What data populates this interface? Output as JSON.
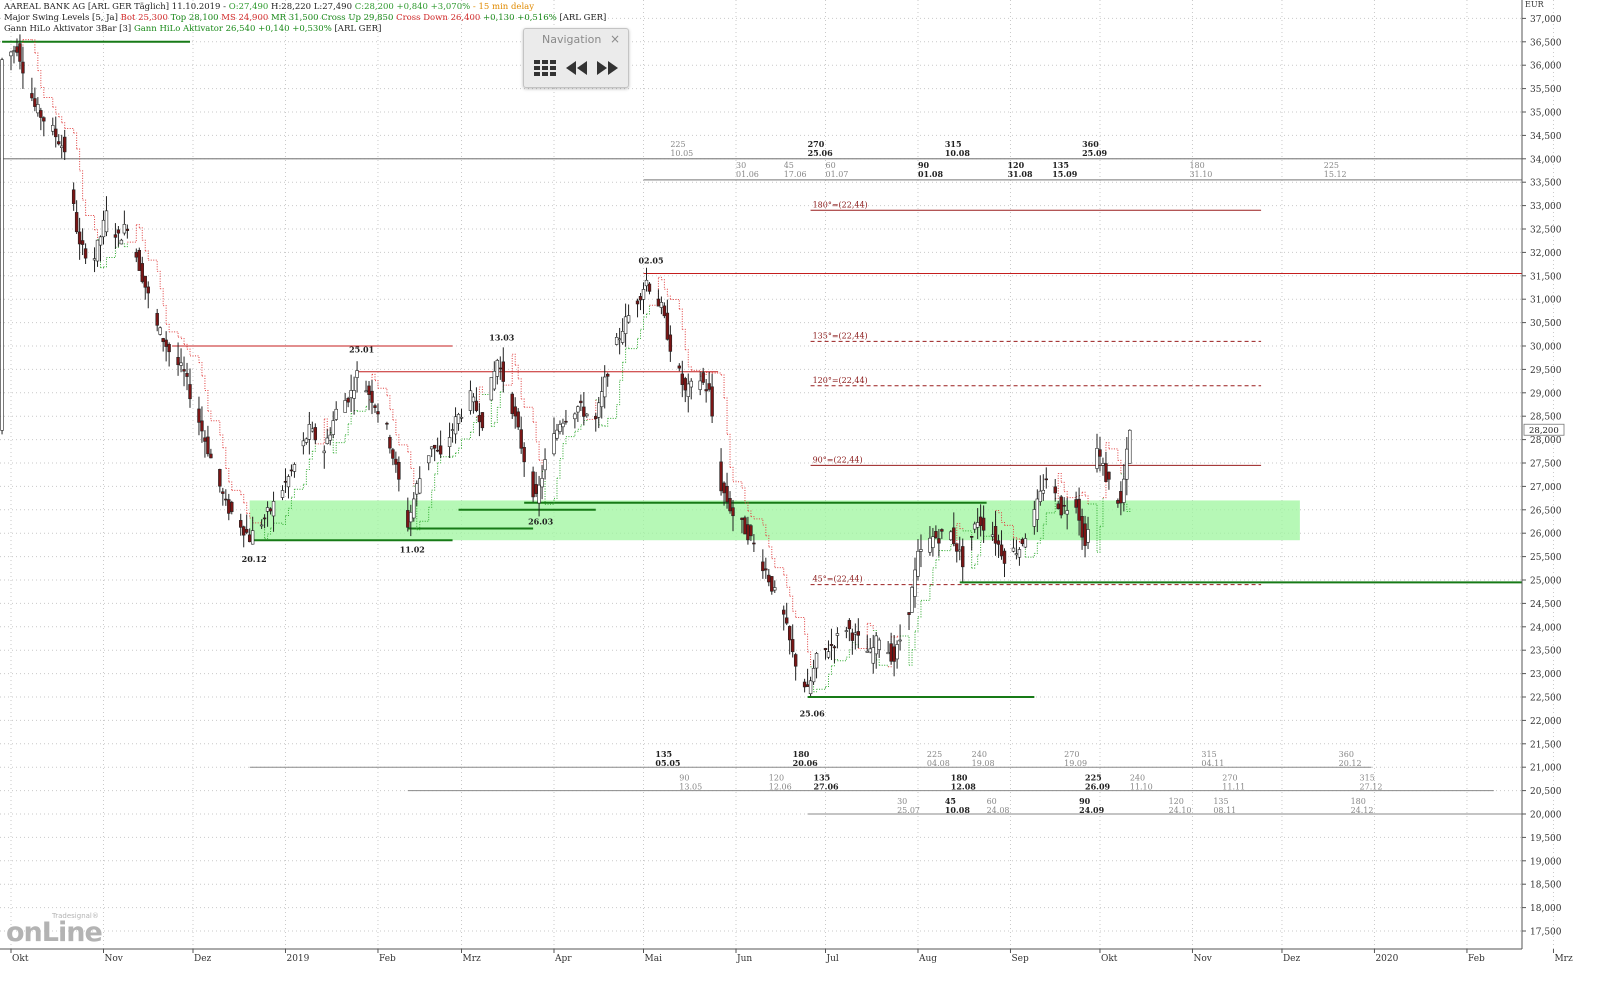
{
  "header": {
    "line1": [
      {
        "text": "AAREAL BANK AG [ARL GER Täglich] 11.10.2019 - ",
        "color": "#222222"
      },
      {
        "text": "O:27,490",
        "color": "#2e9a2e"
      },
      {
        "text": " H:28,220 L:27,490 ",
        "color": "#222222"
      },
      {
        "text": "C:28,200 +0,840 +3,070%",
        "color": "#2e9a2e"
      },
      {
        "text": " - 15 min delay",
        "color": "#e08a00"
      }
    ],
    "line2": [
      {
        "text": "Major Swing Levels [5, Ja] ",
        "color": "#222222"
      },
      {
        "text": "Bot 25,300",
        "color": "#d22a2a"
      },
      {
        "text": " Top 28,100",
        "color": "#1a8a1a"
      },
      {
        "text": " MS 24,900",
        "color": "#d22a2a"
      },
      {
        "text": " MR 31,500",
        "color": "#1a8a1a"
      },
      {
        "text": " Cross Up 29,850",
        "color": "#1a8a1a"
      },
      {
        "text": " Cross Down 26,400",
        "color": "#d22a2a"
      },
      {
        "text": " +0,130 +0,516%",
        "color": "#1a8a1a"
      },
      {
        "text": " [ARL GER]",
        "color": "#222222"
      }
    ],
    "line3": [
      {
        "text": "Gann HiLo Aktivator 3Bar [3] ",
        "color": "#222222"
      },
      {
        "text": "Gann HiLo Aktivator 26,540 +0,140 +0,530%",
        "color": "#1a8a1a"
      },
      {
        "text": " [ARL GER]",
        "color": "#222222"
      }
    ]
  },
  "navigation": {
    "title": "Navigation",
    "close": "×",
    "buttons": [
      "grid-icon",
      "rewind-icon",
      "fast-forward-icon"
    ]
  },
  "logo": {
    "big": "onLine",
    "small": "Tradesignal®"
  },
  "colors": {
    "up": "#ffffff",
    "down": "#7b1515",
    "resistance": "#c41e1e",
    "support": "#177a17",
    "zone": "#9ef59e",
    "gann_up": "#2eaa2e",
    "gann_down": "#e04040"
  },
  "chart_data": {
    "type": "candlestick",
    "currency": "EUR",
    "ylim": [
      17000,
      37500
    ],
    "y_ticks": [
      "17,500",
      "18,000",
      "18,500",
      "19,000",
      "19,500",
      "20,000",
      "20,500",
      "21,000",
      "21,500",
      "22,000",
      "22,500",
      "23,000",
      "23,500",
      "24,000",
      "24,500",
      "25,000",
      "25,500",
      "26,000",
      "26,500",
      "27,000",
      "27,500",
      "28,000",
      "28,500",
      "29,000",
      "29,500",
      "30,000",
      "30,500",
      "31,000",
      "31,500",
      "32,000",
      "32,500",
      "33,000",
      "33,500",
      "34,000",
      "34,500",
      "35,000",
      "35,500",
      "36,000",
      "36,500",
      "37,000"
    ],
    "last_price": "28,200",
    "x_labels": [
      {
        "label": "Okt",
        "date": "2018-10-01"
      },
      {
        "label": "Nov",
        "date": "2018-11-01"
      },
      {
        "label": "Dez",
        "date": "2018-12-01"
      },
      {
        "label": "2019",
        "date": "2019-01-01"
      },
      {
        "label": "Feb",
        "date": "2019-02-01"
      },
      {
        "label": "Mrz",
        "date": "2019-03-01"
      },
      {
        "label": "Apr",
        "date": "2019-04-01"
      },
      {
        "label": "Mai",
        "date": "2019-05-01"
      },
      {
        "label": "Jun",
        "date": "2019-06-01"
      },
      {
        "label": "Jul",
        "date": "2019-07-01"
      },
      {
        "label": "Aug",
        "date": "2019-08-01"
      },
      {
        "label": "Sep",
        "date": "2019-09-01"
      },
      {
        "label": "Okt",
        "date": "2019-10-01"
      },
      {
        "label": "Nov",
        "date": "2019-11-01"
      },
      {
        "label": "Dez",
        "date": "2019-12-01"
      },
      {
        "label": "2020",
        "date": "2020-01-01"
      },
      {
        "label": "Feb",
        "date": "2020-02-01"
      },
      {
        "label": "Mrz",
        "date": "2020-03-01"
      }
    ],
    "xlim": [
      "2018-09-30",
      "2020-03-20"
    ],
    "price_path": [
      [
        "2018-09-28",
        36100
      ],
      [
        "2018-10-03",
        36400
      ],
      [
        "2018-10-09",
        35100
      ],
      [
        "2018-10-15",
        34600
      ],
      [
        "2018-10-19",
        34200
      ],
      [
        "2018-10-24",
        32100
      ],
      [
        "2018-10-29",
        31900
      ],
      [
        "2018-11-02",
        32800
      ],
      [
        "2018-11-06",
        32300
      ],
      [
        "2018-11-09",
        32600
      ],
      [
        "2018-11-14",
        31500
      ],
      [
        "2018-11-19",
        30400
      ],
      [
        "2018-11-23",
        29900
      ],
      [
        "2018-11-28",
        29400
      ],
      [
        "2018-12-03",
        28400
      ],
      [
        "2018-12-07",
        27600
      ],
      [
        "2018-12-12",
        26600
      ],
      [
        "2018-12-17",
        26200
      ],
      [
        "2018-12-20",
        25900
      ],
      [
        "2018-12-27",
        26500
      ],
      [
        "2019-01-03",
        27300
      ],
      [
        "2019-01-09",
        28200
      ],
      [
        "2019-01-14",
        27800
      ],
      [
        "2019-01-18",
        28600
      ],
      [
        "2019-01-23",
        29000
      ],
      [
        "2019-01-25",
        29400
      ],
      [
        "2019-01-30",
        28900
      ],
      [
        "2019-02-04",
        28200
      ],
      [
        "2019-02-08",
        27100
      ],
      [
        "2019-02-11",
        26200
      ],
      [
        "2019-02-14",
        27000
      ],
      [
        "2019-02-19",
        27900
      ],
      [
        "2019-02-22",
        27600
      ],
      [
        "2019-02-27",
        28400
      ],
      [
        "2019-03-04",
        28900
      ],
      [
        "2019-03-08",
        28400
      ],
      [
        "2019-03-13",
        29700
      ],
      [
        "2019-03-18",
        28700
      ],
      [
        "2019-03-22",
        27600
      ],
      [
        "2019-03-26",
        26700
      ],
      [
        "2019-03-29",
        27500
      ],
      [
        "2019-04-03",
        28400
      ],
      [
        "2019-04-09",
        28700
      ],
      [
        "2019-04-15",
        28400
      ],
      [
        "2019-04-19",
        29500
      ],
      [
        "2019-04-24",
        30400
      ],
      [
        "2019-04-29",
        31000
      ],
      [
        "2019-05-02",
        31400
      ],
      [
        "2019-05-07",
        30800
      ],
      [
        "2019-05-10",
        30000
      ],
      [
        "2019-05-15",
        29000
      ],
      [
        "2019-05-20",
        29300
      ],
      [
        "2019-05-23",
        29000
      ],
      [
        "2019-05-27",
        27000
      ],
      [
        "2019-05-31",
        26400
      ],
      [
        "2019-06-05",
        26000
      ],
      [
        "2019-06-11",
        25200
      ],
      [
        "2019-06-17",
        24200
      ],
      [
        "2019-06-20",
        23400
      ],
      [
        "2019-06-25",
        22600
      ],
      [
        "2019-06-28",
        23300
      ],
      [
        "2019-07-03",
        23600
      ],
      [
        "2019-07-08",
        24000
      ],
      [
        "2019-07-12",
        23700
      ],
      [
        "2019-07-16",
        23400
      ],
      [
        "2019-07-19",
        23800
      ],
      [
        "2019-07-24",
        23300
      ],
      [
        "2019-07-29",
        24400
      ],
      [
        "2019-08-01",
        25500
      ],
      [
        "2019-08-06",
        25900
      ],
      [
        "2019-08-12",
        26000
      ],
      [
        "2019-08-16",
        25400
      ],
      [
        "2019-08-21",
        26300
      ],
      [
        "2019-08-26",
        26000
      ],
      [
        "2019-08-30",
        25500
      ],
      [
        "2019-09-04",
        25700
      ],
      [
        "2019-09-09",
        26400
      ],
      [
        "2019-09-13",
        27200
      ],
      [
        "2019-09-18",
        26500
      ],
      [
        "2019-09-23",
        26700
      ],
      [
        "2019-09-26",
        25700
      ],
      [
        "2019-09-30",
        27800
      ],
      [
        "2019-10-03",
        27200
      ],
      [
        "2019-10-08",
        26600
      ],
      [
        "2019-10-11",
        28200
      ]
    ],
    "support_resistance": [
      {
        "price": 36500,
        "from": "2018-09-28",
        "to": "2018-11-30",
        "kind": "support"
      },
      {
        "price": 34000,
        "from": "2018-09-28",
        "to": "2020-03-20",
        "kind": "neutral"
      },
      {
        "price": 33550,
        "from": "2019-05-01",
        "to": "2020-03-20",
        "kind": "neutral"
      },
      {
        "price": 31550,
        "from": "2019-05-01",
        "to": "2020-03-20",
        "kind": "resistance"
      },
      {
        "price": 30000,
        "from": "2018-11-24",
        "to": "2019-02-26",
        "kind": "resistance"
      },
      {
        "price": 29450,
        "from": "2019-01-25",
        "to": "2019-05-26",
        "kind": "resistance"
      },
      {
        "price": 26650,
        "from": "2019-03-22",
        "to": "2019-08-24",
        "kind": "support"
      },
      {
        "price": 26500,
        "from": "2019-02-28",
        "to": "2019-04-15",
        "kind": "support"
      },
      {
        "price": 26100,
        "from": "2019-02-11",
        "to": "2019-03-25",
        "kind": "support"
      },
      {
        "price": 25850,
        "from": "2018-12-20",
        "to": "2019-02-26",
        "kind": "support"
      },
      {
        "price": 24950,
        "from": "2019-08-15",
        "to": "2020-03-20",
        "kind": "support"
      },
      {
        "price": 22500,
        "from": "2019-06-25",
        "to": "2019-09-09",
        "kind": "support"
      }
    ],
    "zone": {
      "from": "2018-12-20",
      "to": "2019-12-07",
      "low": 25850,
      "high": 26700
    },
    "gann_levels": [
      {
        "label": "180°=(22,44)",
        "price": 32900,
        "from": "2019-06-26",
        "to": "2019-11-24",
        "dashed": false
      },
      {
        "label": "135°=(22,44)",
        "price": 30100,
        "from": "2019-06-26",
        "to": "2019-11-24",
        "dashed": true
      },
      {
        "label": "120°=(22,44)",
        "price": 29150,
        "from": "2019-06-26",
        "to": "2019-11-24",
        "dashed": true
      },
      {
        "label": "90°=(22,44)",
        "price": 27450,
        "from": "2019-06-26",
        "to": "2019-11-24",
        "dashed": false
      },
      {
        "label": "45°=(22,44)",
        "price": 24900,
        "from": "2019-06-26",
        "to": "2019-11-24",
        "dashed": true
      }
    ],
    "swing_labels": [
      {
        "label": "20.12",
        "date": "2018-12-20",
        "price": 25600,
        "below": true
      },
      {
        "label": "11.02",
        "date": "2019-02-11",
        "price": 25800,
        "below": true
      },
      {
        "label": "25.01",
        "date": "2019-01-25",
        "price": 29800,
        "below": false
      },
      {
        "label": "13.03",
        "date": "2019-03-13",
        "price": 30050,
        "below": false
      },
      {
        "label": "26.03",
        "date": "2019-03-26",
        "price": 26400,
        "below": true
      },
      {
        "label": "02.05",
        "date": "2019-05-02",
        "price": 31700,
        "below": false
      },
      {
        "label": "25.06",
        "date": "2019-06-25",
        "price": 22300,
        "below": true
      }
    ],
    "time_cycles": [
      {
        "line_price": 34000,
        "line_from": "2018-09-28",
        "line_to": "2020-03-20",
        "labels": [
          {
            "deg": "225",
            "date": "10.05",
            "bold": false
          },
          {
            "deg": "270",
            "date": "25.06",
            "bold": true
          },
          {
            "deg": "315",
            "date": "10.08",
            "bold": true
          },
          {
            "deg": "360",
            "date": "25.09",
            "bold": true
          }
        ]
      },
      {
        "line_price": 33550,
        "line_from": "2019-05-01",
        "line_to": "2020-03-20",
        "labels": [
          {
            "deg": "30",
            "date": "01.06",
            "bold": false
          },
          {
            "deg": "45",
            "date": "17.06",
            "bold": false
          },
          {
            "deg": "60",
            "date": "01.07",
            "bold": false
          },
          {
            "deg": "90",
            "date": "01.08",
            "bold": true
          },
          {
            "deg": "120",
            "date": "31.08",
            "bold": true
          },
          {
            "deg": "135",
            "date": "15.09",
            "bold": true
          },
          {
            "deg": "180",
            "date": "31.10",
            "bold": false
          },
          {
            "deg": "225",
            "date": "15.12",
            "bold": false
          }
        ]
      },
      {
        "line_price": 21000,
        "line_from": "2018-12-20",
        "line_to": "2019-12-31",
        "labels": [
          {
            "deg": "135",
            "date": "05.05",
            "bold": true
          },
          {
            "deg": "180",
            "date": "20.06",
            "bold": true
          },
          {
            "deg": "225",
            "date": "04.08",
            "bold": false
          },
          {
            "deg": "240",
            "date": "19.08",
            "bold": false
          },
          {
            "deg": "270",
            "date": "19.09",
            "bold": false
          },
          {
            "deg": "315",
            "date": "04.11",
            "bold": false
          },
          {
            "deg": "360",
            "date": "20.12",
            "bold": false
          }
        ]
      },
      {
        "line_price": 20500,
        "line_from": "2019-02-11",
        "line_to": "2020-02-10",
        "labels": [
          {
            "deg": "90",
            "date": "13.05",
            "bold": false
          },
          {
            "deg": "120",
            "date": "12.06",
            "bold": false
          },
          {
            "deg": "135",
            "date": "27.06",
            "bold": true
          },
          {
            "deg": "180",
            "date": "12.08",
            "bold": true
          },
          {
            "deg": "225",
            "date": "26.09",
            "bold": true
          },
          {
            "deg": "240",
            "date": "11.10",
            "bold": false
          },
          {
            "deg": "270",
            "date": "11.11",
            "bold": false
          },
          {
            "deg": "315",
            "date": "27.12",
            "bold": false
          }
        ]
      },
      {
        "line_price": 20000,
        "line_from": "2019-06-25",
        "line_to": "2020-03-20",
        "labels": [
          {
            "deg": "30",
            "date": "25.07",
            "bold": false
          },
          {
            "deg": "45",
            "date": "10.08",
            "bold": true
          },
          {
            "deg": "60",
            "date": "24.08",
            "bold": false
          },
          {
            "deg": "90",
            "date": "24.09",
            "bold": true
          },
          {
            "deg": "120",
            "date": "24.10",
            "bold": false
          },
          {
            "deg": "135",
            "date": "08.11",
            "bold": false
          },
          {
            "deg": "180",
            "date": "24.12",
            "bold": false
          }
        ]
      }
    ]
  }
}
